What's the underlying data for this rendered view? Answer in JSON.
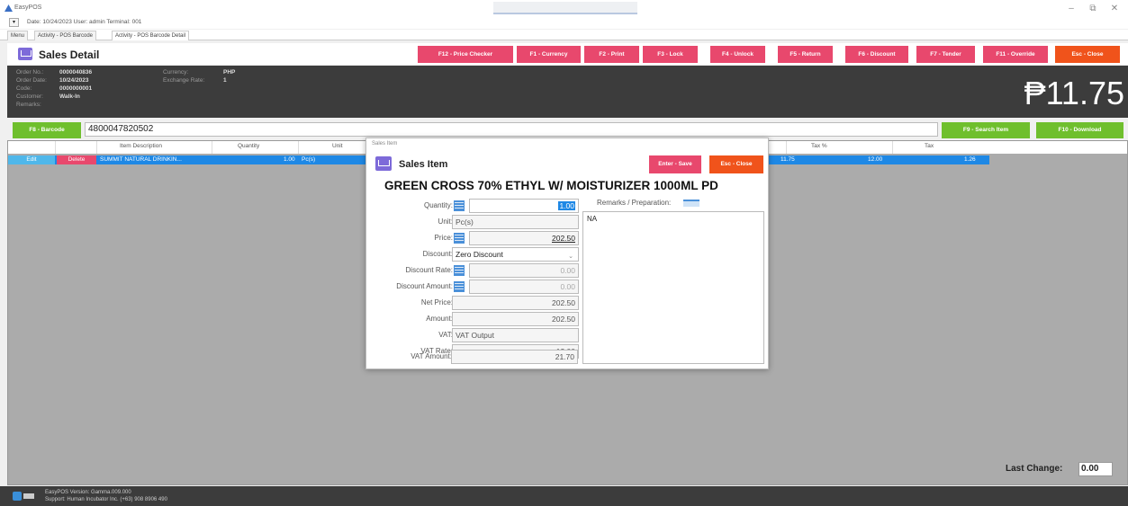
{
  "app": {
    "title": "EasyPOS"
  },
  "info": {
    "text": "Date: 10/24/2023   User: admin   Terminal: 001"
  },
  "tabs": [
    "Menu",
    "Activity - POS Barcode",
    "Activity - POS Barcode Detail"
  ],
  "header": {
    "title": "Sales Detail"
  },
  "fkeys": [
    "F12 - Price Checker",
    "F1 - Currency",
    "F2 - Print",
    "F3 - Lock",
    "F4 - Unlock",
    "F5 - Return",
    "F6 - Discount",
    "F7 - Tender",
    "F11 - Override",
    "Esc - Close"
  ],
  "order": {
    "order_no_label": "Order No.:",
    "order_no": "0000040836",
    "order_date_label": "Order Date:",
    "order_date": "10/24/2023",
    "code_label": "Code:",
    "code": "0000000001",
    "customer_label": "Customer:",
    "customer": "Walk-In",
    "remarks_label": "Remarks:",
    "currency_label": "Currency:",
    "currency": "PHP",
    "exchange_label": "Exchange Rate:",
    "exchange": "1",
    "total": "₱11.75"
  },
  "barcode": {
    "button": "F8 - Barcode",
    "value": "4800047820502",
    "search": "F9 - Search Item",
    "download": "F10 - Download"
  },
  "grid": {
    "headers": [
      "Item Description",
      "Quantity",
      "Unit",
      "Tax %",
      "Tax"
    ],
    "row": {
      "edit": "Edit",
      "delete": "Delete",
      "description": "SUMMIT NATURAL DRINKIN...",
      "quantity": "1.00",
      "unit": "Pc(s)",
      "amount": "11.75",
      "tax_rate": "12.00",
      "tax": "1.26"
    }
  },
  "last_change": {
    "label": "Last Change:",
    "value": "0.00"
  },
  "footer": {
    "version": "EasyPOS Version: Gamma.009.000",
    "support": "Support: Human Incubator Inc. (+63) 908 8906 490"
  },
  "modal": {
    "window_title": "Sales Item",
    "heading": "Sales Item",
    "save": "Enter - Save",
    "close": "Esc - Close",
    "product": "GREEN CROSS 70% ETHYL W/ MOISTURIZER 1000ML PD",
    "quantity_label": "Quantity:",
    "quantity": "1.00",
    "unit_label": "Unit:",
    "unit": "Pc(s)",
    "price_label": "Price:",
    "price": "202.50",
    "discount_label": "Discount:",
    "discount": "Zero Discount",
    "discount_rate_label": "Discount Rate:",
    "discount_rate": "0.00",
    "discount_amount_label": "Discount Amount:",
    "discount_amount": "0.00",
    "net_price_label": "Net Price:",
    "net_price": "202.50",
    "amount_label": "Amount:",
    "amount": "202.50",
    "vat_label": "VAT:",
    "vat": "VAT Output",
    "vat_rate_label": "VAT Rate:",
    "vat_rate": "12.00",
    "vat_amount_label": "VAT Amount:",
    "vat_amount": "21.70",
    "remarks_label": "Remarks / Preparation:",
    "remarks": "NA"
  }
}
